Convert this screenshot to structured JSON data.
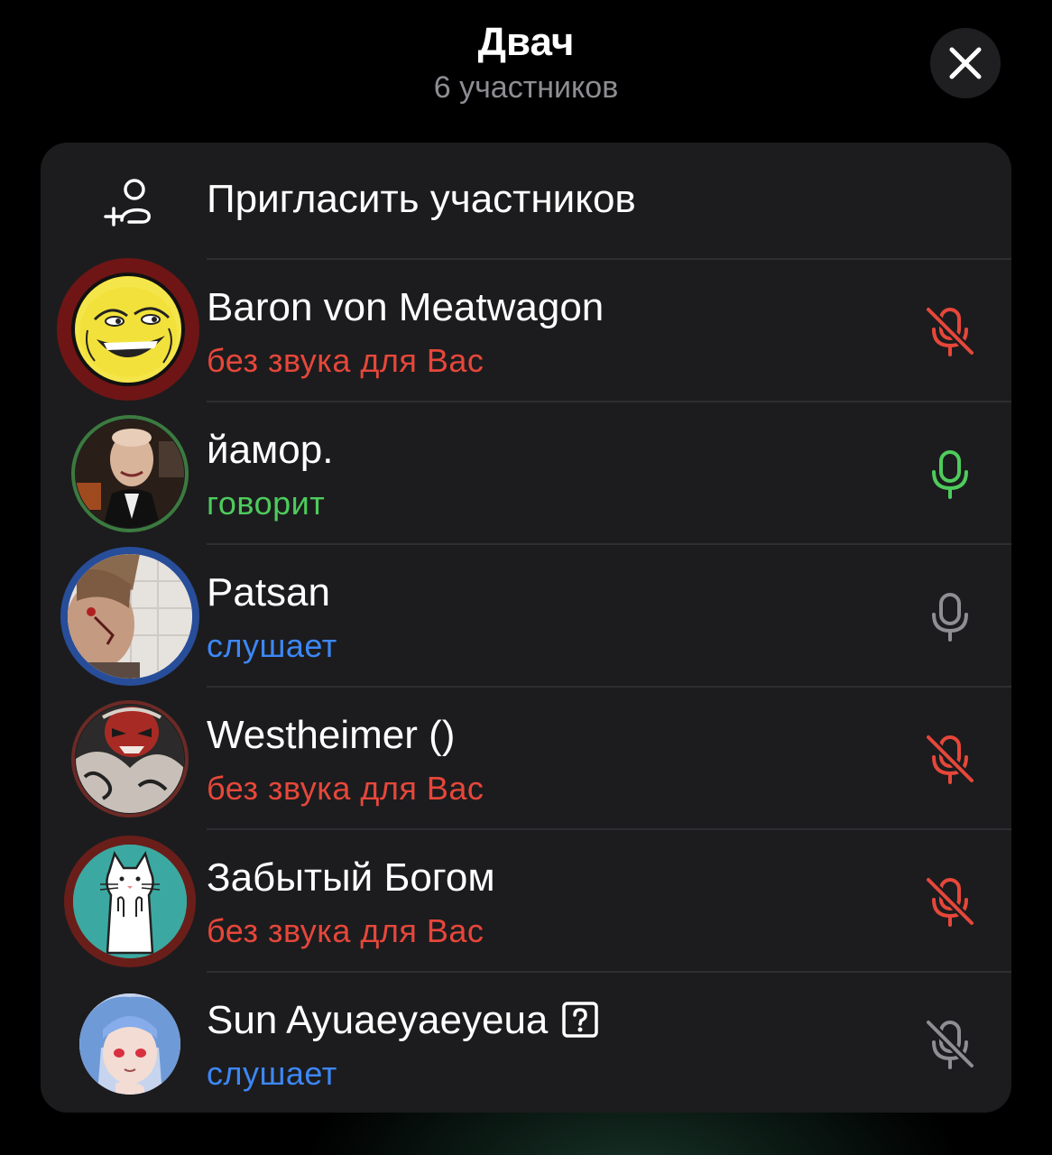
{
  "header": {
    "title": "Двач",
    "subtitle": "6 участников"
  },
  "invite": {
    "label": "Пригласить участников",
    "icon": "add-user-icon"
  },
  "colors": {
    "muted": "#e6473a",
    "speaking": "#4ecb5c",
    "listening": "#3d87f5",
    "mic_neutral": "#8e8e93"
  },
  "participants": [
    {
      "name": "Baron von Meatwagon",
      "status": "без звука для Вас",
      "state": "muted-for-you",
      "mic_icon": "mic-muted-icon",
      "avatar": "troll-face-avatar"
    },
    {
      "name": "йамор.",
      "status": "говорит",
      "state": "speaking",
      "mic_icon": "mic-icon",
      "avatar": "photo-avatar"
    },
    {
      "name": "Patsan",
      "status": "слушает",
      "state": "listening",
      "mic_icon": "mic-icon",
      "avatar": "photo-avatar"
    },
    {
      "name": "Westheimer ()",
      "status": "без звука для Вас",
      "state": "muted-for-you",
      "mic_icon": "mic-muted-icon",
      "avatar": "mask-avatar"
    },
    {
      "name": "Забытый Богом",
      "status": "без звука для Вас",
      "state": "muted-for-you",
      "mic_icon": "mic-muted-icon",
      "avatar": "cat-avatar"
    },
    {
      "name": "Sun Ayuaeyaeyeua",
      "status": "слушает",
      "state": "listening",
      "mic_icon": "mic-muted-icon",
      "avatar": "anime-avatar",
      "badge_icon": "question-badge-icon"
    }
  ]
}
